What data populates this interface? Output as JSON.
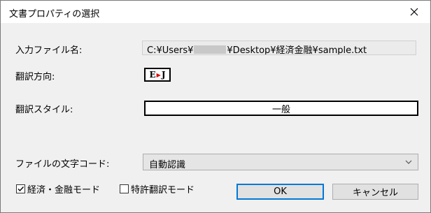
{
  "window": {
    "title": "文書プロパティの選択",
    "close_glyph": "✕"
  },
  "fields": {
    "input_file_label": "入力ファイル名:",
    "input_file_prefix": "C:¥Users¥",
    "input_file_suffix": "¥Desktop¥経済金融¥sample.txt",
    "direction_label": "翻訳方向:",
    "direction_from": "E",
    "direction_arrow": "▶",
    "direction_to": "J",
    "style_label": "翻訳スタイル:",
    "style_value": "一般",
    "encoding_label": "ファイルの文字コード:",
    "encoding_value": "自動認識"
  },
  "options": {
    "economy_mode_label": "経済・金融モード",
    "economy_mode_checked": true,
    "patent_mode_label": "特許翻訳モード",
    "patent_mode_checked": false
  },
  "buttons": {
    "ok_label": "OK",
    "cancel_label": "キャンセル"
  }
}
